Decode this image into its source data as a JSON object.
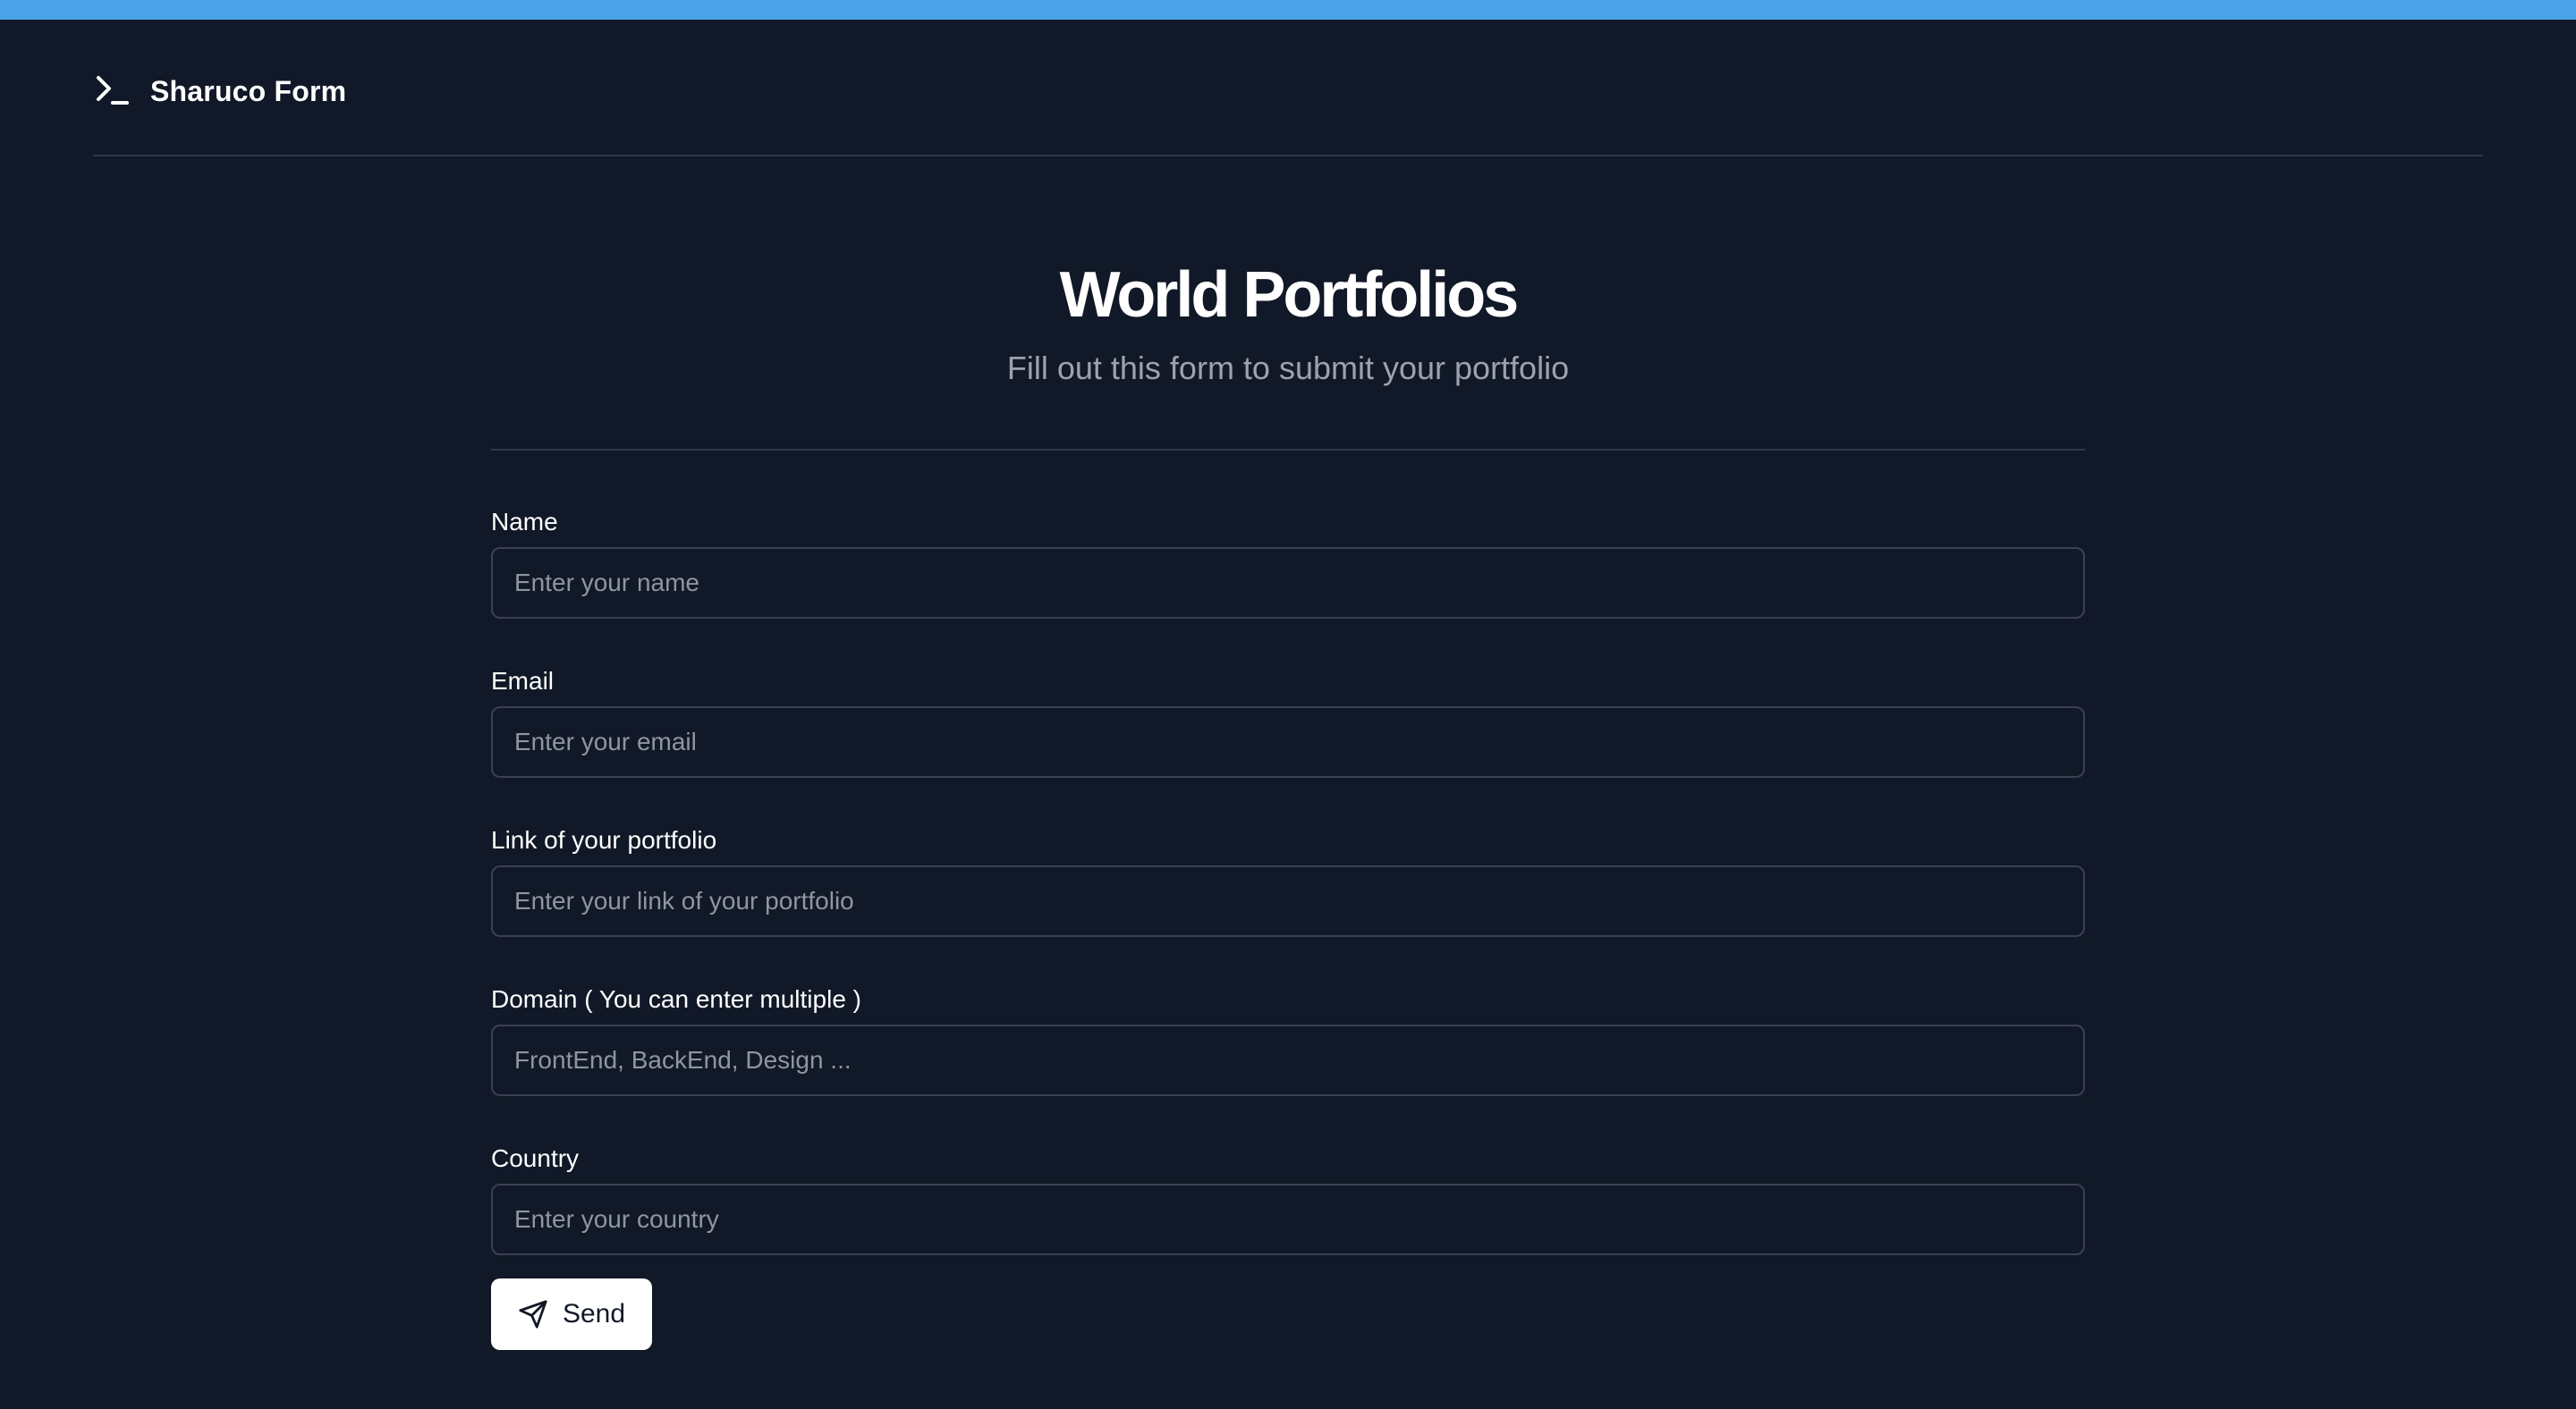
{
  "header": {
    "logo_icon": "terminal-prompt-icon",
    "title": "Sharuco Form"
  },
  "hero": {
    "title": "World Portfolios",
    "subtitle": "Fill out this form to submit your portfolio"
  },
  "form": {
    "fields": [
      {
        "label": "Name",
        "placeholder": "Enter your name",
        "value": ""
      },
      {
        "label": "Email",
        "placeholder": "Enter your email",
        "value": ""
      },
      {
        "label": "Link of your portfolio",
        "placeholder": "Enter your link of your portfolio",
        "value": ""
      },
      {
        "label": "Domain ( You can enter multiple )",
        "placeholder": "FrontEnd, BackEnd, Design ...",
        "value": ""
      },
      {
        "label": "Country",
        "placeholder": "Enter your country",
        "value": ""
      }
    ],
    "submit": {
      "icon": "send-icon",
      "label": "Send"
    }
  },
  "colors": {
    "background": "#111827",
    "top_bar": "#4aa3e6",
    "divider": "#313848",
    "input_border": "#3a4152",
    "subtitle": "#9ca3af",
    "button_bg": "#ffffff"
  }
}
